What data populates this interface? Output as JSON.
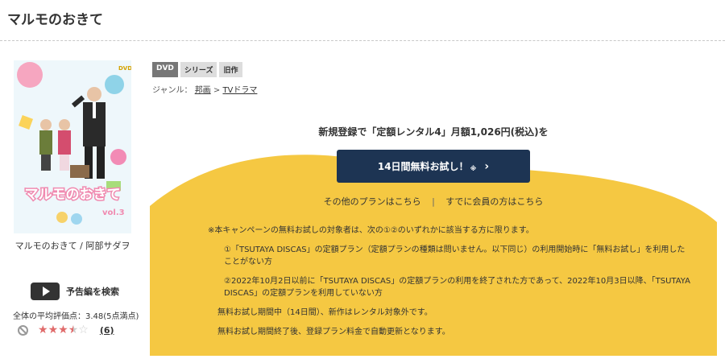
{
  "page": {
    "title": "マルモのおきて"
  },
  "jacket": {
    "logo_text": "マルモのおきて",
    "vol_label": "vol.3",
    "dvd_badge": "DVD"
  },
  "work": {
    "caption": "マルモのおきて / 阿部サダヲ"
  },
  "trailer": {
    "label": "予告編を検索"
  },
  "rating": {
    "average_text": "全体の平均評価点：3.48(5点満点)",
    "stars": 3.5,
    "stars_text": "★★★★☆",
    "review_count": "(6)"
  },
  "tags": [
    "DVD",
    "シリーズ",
    "旧作"
  ],
  "genre": {
    "label": "ジャンル：",
    "items": [
      "邦画",
      "TVドラマ"
    ],
    "separator": ">"
  },
  "campaign": {
    "headline": "新規登録で「定額レンタル4」月額1,026円(税込)を",
    "button_label": "14日間無料お試し！",
    "button_mark": "※",
    "button_chevron": "›",
    "link_other_plans": "その他のプランはこちら",
    "link_separator": "|",
    "link_member": "すでに会員の方はこちら",
    "accent_color": "#f5c842",
    "button_color": "#1d3453"
  },
  "notes": [
    "※本キャンペーンの無料お試しの対象者は、次の①②のいずれかに該当する方に限ります。",
    "①「TSUTAYA DISCAS」の定額プラン（定額プランの種類は問いません。以下同じ）の利用開始時に「無料お試し」を利用したことがない方",
    "②2022年10月2日以前に「TSUTAYA DISCAS」の定額プランの利用を終了された方であって、2022年10月3日以降、「TSUTAYA DISCAS」の定額プランを利用していない方",
    "無料お試し期間中（14日間）、新作はレンタル対象外です。",
    "無料お試し期間終了後、登録プラン料金で自動更新となります。"
  ]
}
